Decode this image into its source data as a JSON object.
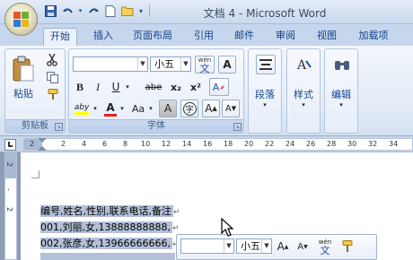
{
  "window": {
    "title": "文档 4 - Microsoft Word"
  },
  "quick_access": {
    "icons": [
      "save-icon",
      "undo-icon",
      "redo-icon",
      "new-document-icon",
      "open-icon",
      "customize-icon"
    ]
  },
  "tabs": [
    "开始",
    "插入",
    "页面布局",
    "引用",
    "邮件",
    "审阅",
    "视图",
    "加载项"
  ],
  "active_tab": "开始",
  "ribbon": {
    "clipboard": {
      "label": "剪贴板",
      "paste_label": "粘贴"
    },
    "font": {
      "label": "字体",
      "font_name": "",
      "font_size": "小五",
      "pinyin_top": "wén",
      "pinyin_char": "文",
      "border_char": "A",
      "bold": "B",
      "italic": "I",
      "underline": "U",
      "strike": "abe",
      "subscript": "x₂",
      "superscript": "x²",
      "clear_format": "A",
      "highlight": "aby",
      "font_color": "A",
      "case": "Aa",
      "shading_char": "A",
      "enclose_char": "字",
      "grow": "A",
      "shrink": "A"
    },
    "paragraph": {
      "label": "段落"
    },
    "styles": {
      "label": "样式"
    },
    "editing": {
      "label": "编辑"
    }
  },
  "ruler": {
    "ticks": [
      "2",
      "2",
      "4",
      "6",
      "8",
      "10",
      "12",
      "14",
      "16",
      "18",
      "20",
      "22",
      "24",
      "26",
      "28",
      "30",
      "32",
      "34"
    ],
    "vticks": [
      "2",
      "-",
      "2"
    ]
  },
  "document": {
    "lines": [
      "编号,姓名,性别,联系电话,备注",
      "001,刘丽,女,13888888888,",
      "002,张彦,女,13966666666,"
    ],
    "para_mark": "↵"
  },
  "mini_toolbar": {
    "font_name": "",
    "font_size": "小五",
    "grow": "A",
    "shrink": "A",
    "pinyin_top": "wén",
    "pinyin_char": "文"
  }
}
